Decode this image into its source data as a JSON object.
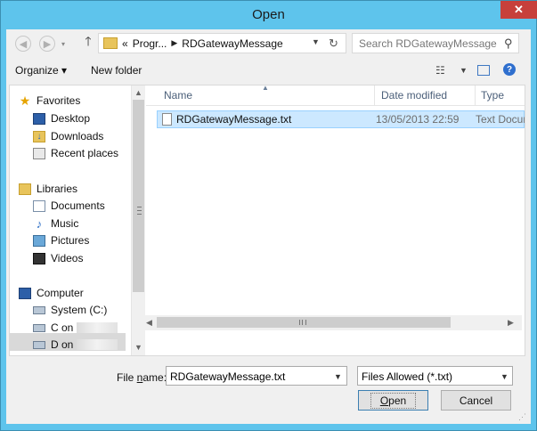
{
  "window": {
    "title": "Open",
    "close_glyph": "✕"
  },
  "navigation": {
    "back_icon": "back-arrow-icon",
    "forward_icon": "forward-arrow-icon",
    "up_icon": "up-arrow-icon",
    "breadcrumb_overflow": "«",
    "breadcrumb": [
      "Progr...",
      "RDGatewayMessage"
    ],
    "search_placeholder": "Search RDGatewayMessage"
  },
  "toolbar": {
    "organize_label": "Organize ▾",
    "new_folder_label": "New folder"
  },
  "sidebar": {
    "favorites": {
      "label": "Favorites",
      "items": [
        "Desktop",
        "Downloads",
        "Recent places"
      ]
    },
    "libraries": {
      "label": "Libraries",
      "items": [
        "Documents",
        "Music",
        "Pictures",
        "Videos"
      ]
    },
    "computer": {
      "label": "Computer",
      "items": [
        "System (C:)",
        "C on",
        "D on"
      ]
    }
  },
  "file_list": {
    "columns": [
      "Name",
      "Date modified",
      "Type"
    ],
    "rows": [
      {
        "name": "RDGatewayMessage.txt",
        "date_modified": "13/05/2013 22:59",
        "type": "Text Docume"
      }
    ]
  },
  "bottom": {
    "file_name_label_pre": "File ",
    "file_name_label_mnemonic": "n",
    "file_name_label_post": "ame:",
    "file_name_value": "RDGatewayMessage.txt",
    "filter_value": "Files Allowed (*.txt)",
    "open_label_mnemonic": "O",
    "open_label_rest": "pen",
    "cancel_label": "Cancel"
  },
  "colors": {
    "titlebar": "#5ec4ec",
    "close_button": "#c7403b",
    "selection": "#cce8ff"
  }
}
